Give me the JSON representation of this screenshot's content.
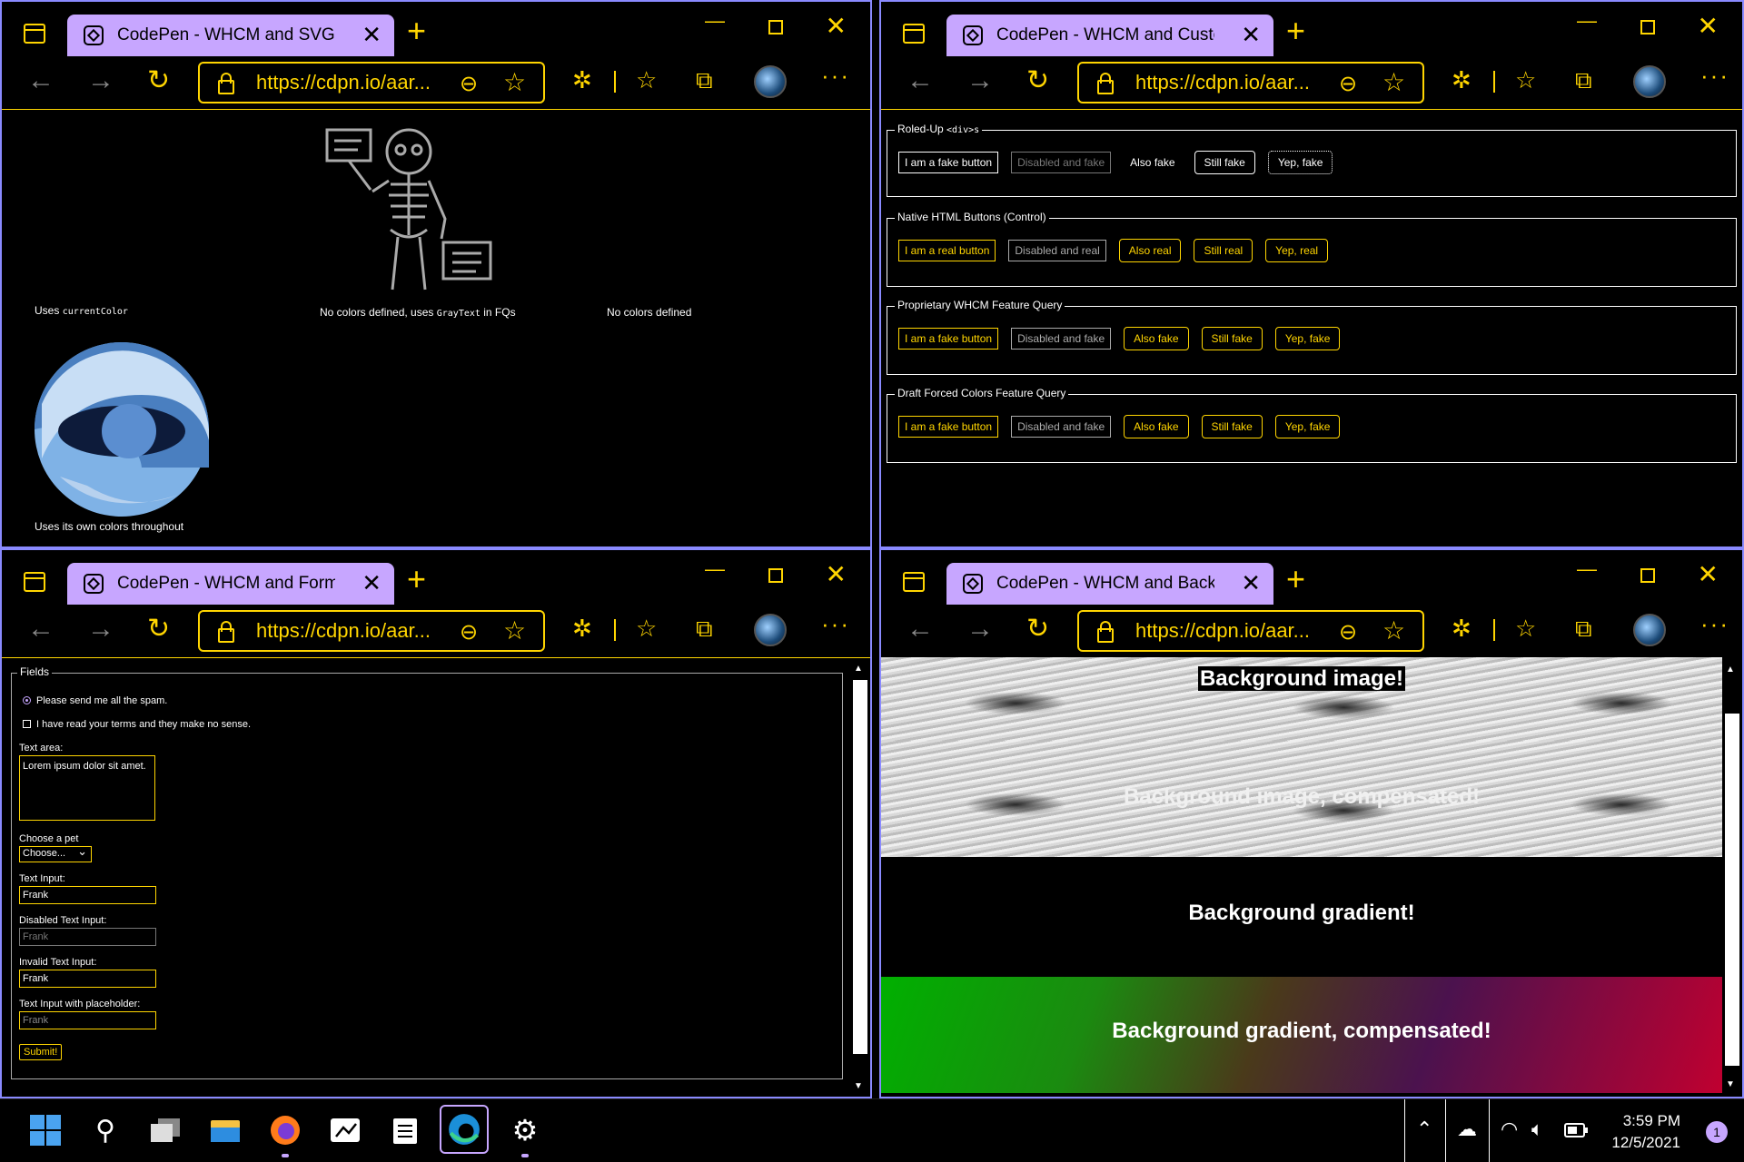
{
  "windows": {
    "tl": {
      "tab_title": "CodePen - WHCM and SVGs",
      "url": "https://cdpn.io/aar..."
    },
    "tr": {
      "tab_title": "CodePen - WHCM and Custom E",
      "url": "https://cdpn.io/aar..."
    },
    "bl": {
      "tab_title": "CodePen - WHCM and Form Cor",
      "url": "https://cdpn.io/aar..."
    },
    "br": {
      "tab_title": "CodePen - WHCM and Backgrou",
      "url": "https://cdpn.io/aar..."
    }
  },
  "browser_ui": {
    "new_tab": "+",
    "close_tab": "✕",
    "minimize": "—",
    "close_window": "✕",
    "more": "···"
  },
  "svgs": {
    "caption1_prefix": "Uses ",
    "caption1_code": "currentColor",
    "caption2_prefix": "No colors defined, uses ",
    "caption2_code": "GrayText",
    "caption2_suffix": " in FQs",
    "caption3": "No colors defined",
    "caption4": "Uses its own colors throughout"
  },
  "custom": {
    "groups": [
      {
        "legend_text": "Roled-Up ",
        "legend_code": "<div>s",
        "buttons": [
          "I am a fake button",
          "Disabled and fake",
          "Also fake",
          "Still fake",
          "Yep, fake"
        ]
      },
      {
        "legend_text": "Native HTML Buttons (Control)",
        "buttons": [
          "I am a real button",
          "Disabled and real",
          "Also real",
          "Still real",
          "Yep, real"
        ]
      },
      {
        "legend_text": "Proprietary WHCM Feature Query",
        "buttons": [
          "I am a fake button",
          "Disabled and fake",
          "Also fake",
          "Still fake",
          "Yep, fake"
        ]
      },
      {
        "legend_text": "Draft Forced Colors Feature Query",
        "buttons": [
          "I am a fake button",
          "Disabled and fake",
          "Also fake",
          "Still fake",
          "Yep, fake"
        ]
      }
    ]
  },
  "form": {
    "legend": "Fields",
    "radio_label": "Please send me all the spam.",
    "checkbox_label": "I have read your terms and they make no sense.",
    "textarea_label": "Text area:",
    "textarea_value": "Lorem ipsum dolor sit amet.",
    "select_label": "Choose a pet",
    "select_value": "Choose...",
    "text_label": "Text Input:",
    "text_value": "Frank",
    "disabled_label": "Disabled Text Input:",
    "disabled_value": "Frank",
    "invalid_label": "Invalid Text Input:",
    "invalid_value": "Frank",
    "placeholder_label": "Text Input with placeholder:",
    "placeholder_value": "Frank",
    "submit": "Submit!"
  },
  "backgrounds": {
    "label1": "Background image!",
    "label2": "Background image, compensated!",
    "label3": "Background gradient!",
    "label4": "Background gradient, compensated!"
  },
  "taskbar": {
    "time": "3:59 PM",
    "date": "12/5/2021",
    "notification_count": "1"
  },
  "colors": {
    "accent": "#ffd500",
    "tab": "#c7a6ff",
    "border": "#8a8aff"
  }
}
